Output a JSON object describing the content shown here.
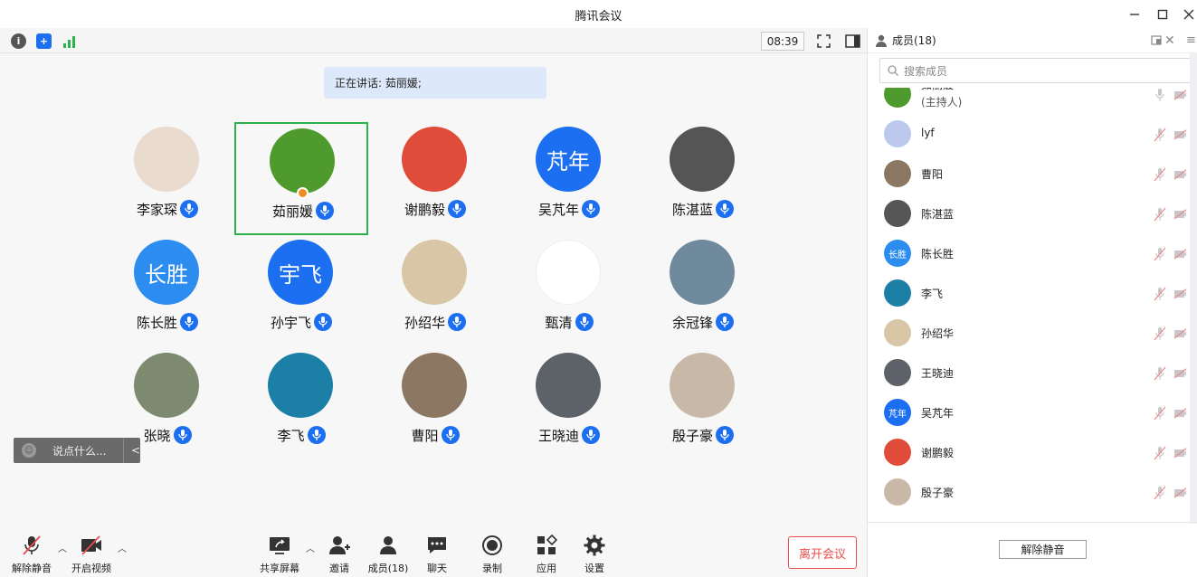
{
  "window": {
    "title": "腾讯会议"
  },
  "topbar": {
    "timer": "08:39"
  },
  "speaking": {
    "label": "正在讲话:",
    "name": "茹丽媛;"
  },
  "participants": [
    {
      "name": "李家琛",
      "avatar_text": "",
      "avatar_color": "#e9dccf"
    },
    {
      "name": "茹丽媛",
      "avatar_text": "",
      "avatar_color": "#4e9a2c",
      "host": true
    },
    {
      "name": "谢鹏毅",
      "avatar_text": "",
      "avatar_color": "#e04b3a"
    },
    {
      "name": "吴芃年",
      "avatar_text": "芃年",
      "avatar_color": "#1b6ff0"
    },
    {
      "name": "陈湛蓝",
      "avatar_text": "",
      "avatar_color": "#555555"
    },
    {
      "name": "陈长胜",
      "avatar_text": "长胜",
      "avatar_color": "#2d8cf0"
    },
    {
      "name": "孙宇飞",
      "avatar_text": "宇飞",
      "avatar_color": "#1b6ff0"
    },
    {
      "name": "孙绍华",
      "avatar_text": "",
      "avatar_color": "#d8c6a6"
    },
    {
      "name": "甄清",
      "avatar_text": "",
      "avatar_color": "#ffffff"
    },
    {
      "name": "余冠锋",
      "avatar_text": "",
      "avatar_color": "#6f8a9c"
    },
    {
      "name": "张晓",
      "avatar_text": "",
      "avatar_color": "#7d8a70"
    },
    {
      "name": "李飞",
      "avatar_text": "",
      "avatar_color": "#1c7fa6"
    },
    {
      "name": "曹阳",
      "avatar_text": "",
      "avatar_color": "#8c7862"
    },
    {
      "name": "王晓迪",
      "avatar_text": "",
      "avatar_color": "#5c6268"
    },
    {
      "name": "殷子豪",
      "avatar_text": "",
      "avatar_color": "#c8b8a8"
    }
  ],
  "chat": {
    "placeholder": "说点什么...",
    "collapse": "<"
  },
  "bottombar": {
    "unmute": "解除静音",
    "video": "开启视频",
    "share": "共享屏幕",
    "invite": "邀请",
    "members": "成员(18)",
    "chat": "聊天",
    "record": "录制",
    "apps": "应用",
    "settings": "设置",
    "leave": "离开会议"
  },
  "panel": {
    "title": "成员(18)",
    "search_placeholder": "搜索成员",
    "unmute_button": "解除静音",
    "members": [
      {
        "name": "茹丽媛",
        "sub": "(主持人)",
        "avatar_text": "",
        "avatar_color": "#4e9a2c"
      },
      {
        "name": "lyf",
        "sub": "",
        "avatar_text": "",
        "avatar_color": "#bcc8ec"
      },
      {
        "name": "曹阳",
        "sub": "",
        "avatar_text": "",
        "avatar_color": "#8c7862"
      },
      {
        "name": "陈湛蓝",
        "sub": "",
        "avatar_text": "",
        "avatar_color": "#555555"
      },
      {
        "name": "陈长胜",
        "sub": "",
        "avatar_text": "长胜",
        "avatar_color": "#2d8cf0"
      },
      {
        "name": "李飞",
        "sub": "",
        "avatar_text": "",
        "avatar_color": "#1c7fa6"
      },
      {
        "name": "孙绍华",
        "sub": "",
        "avatar_text": "",
        "avatar_color": "#d8c6a6"
      },
      {
        "name": "王晓迪",
        "sub": "",
        "avatar_text": "",
        "avatar_color": "#5c6268"
      },
      {
        "name": "吴芃年",
        "sub": "",
        "avatar_text": "芃年",
        "avatar_color": "#1b6ff0"
      },
      {
        "name": "谢鹏毅",
        "sub": "",
        "avatar_text": "",
        "avatar_color": "#e04b3a"
      },
      {
        "name": "殷子豪",
        "sub": "",
        "avatar_text": "",
        "avatar_color": "#c8b8a8"
      }
    ]
  },
  "colors": {
    "accent": "#1b6ff0",
    "active_border": "#2bb24c",
    "leave": "#e84c4c"
  }
}
